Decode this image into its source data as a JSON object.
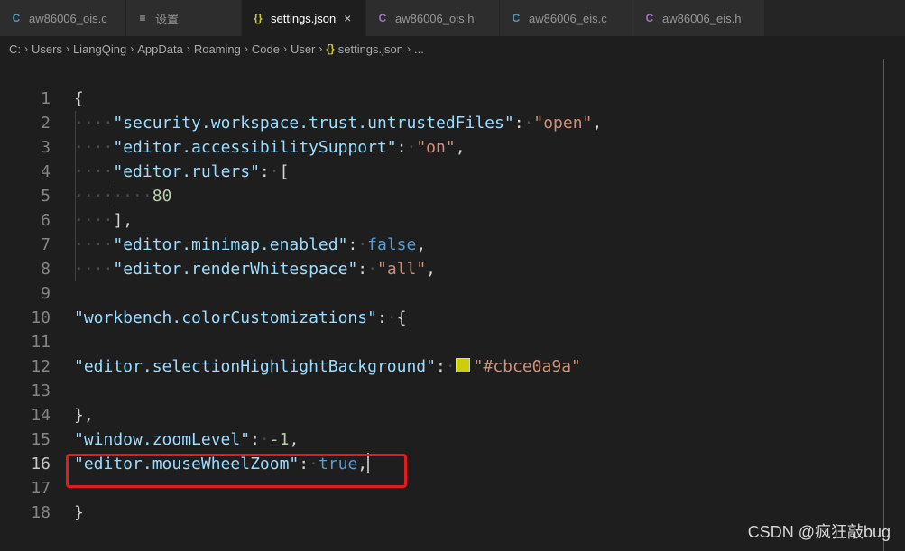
{
  "tabs": [
    {
      "label": "aw86006_ois.c",
      "icon": "C",
      "icon_color": "#519aba",
      "active": false
    },
    {
      "label": "设置",
      "icon": "≡",
      "icon_color": "#c5c5c5",
      "active": false
    },
    {
      "label": "settings.json",
      "icon": "{}",
      "icon_color": "#cbcb41",
      "active": true,
      "close": "×"
    },
    {
      "label": "aw86006_ois.h",
      "icon": "C",
      "icon_color": "#a074c4",
      "active": false
    },
    {
      "label": "aw86006_eis.c",
      "icon": "C",
      "icon_color": "#519aba",
      "active": false
    },
    {
      "label": "aw86006_eis.h",
      "icon": "C",
      "icon_color": "#a074c4",
      "active": false
    }
  ],
  "breadcrumb": {
    "items": [
      "C:",
      "Users",
      "LiangQing",
      "AppData",
      "Roaming",
      "Code",
      "User",
      "settings.json",
      "..."
    ],
    "file_icon": "{}"
  },
  "editor": {
    "current_line": "16",
    "lines": [
      {
        "num": "1",
        "tokens": [
          {
            "t": "p",
            "v": "{"
          }
        ]
      },
      {
        "num": "2",
        "tokens": [
          {
            "t": "ws",
            "v": "····"
          },
          {
            "t": "k",
            "v": "\"security.workspace.trust.untrustedFiles\""
          },
          {
            "t": "p",
            "v": ":"
          },
          {
            "t": "ws",
            "v": "·"
          },
          {
            "t": "s",
            "v": "\"open\""
          },
          {
            "t": "p",
            "v": ","
          }
        ]
      },
      {
        "num": "3",
        "tokens": [
          {
            "t": "ws",
            "v": "····"
          },
          {
            "t": "k",
            "v": "\"editor.accessibilitySupport\""
          },
          {
            "t": "p",
            "v": ":"
          },
          {
            "t": "ws",
            "v": "·"
          },
          {
            "t": "s",
            "v": "\"on\""
          },
          {
            "t": "p",
            "v": ","
          }
        ]
      },
      {
        "num": "4",
        "tokens": [
          {
            "t": "ws",
            "v": "····"
          },
          {
            "t": "k",
            "v": "\"editor.rulers\""
          },
          {
            "t": "p",
            "v": ":"
          },
          {
            "t": "ws",
            "v": "·"
          },
          {
            "t": "p",
            "v": "["
          }
        ]
      },
      {
        "num": "5",
        "tokens": [
          {
            "t": "ws",
            "v": "········"
          },
          {
            "t": "n",
            "v": "80"
          }
        ]
      },
      {
        "num": "6",
        "tokens": [
          {
            "t": "ws",
            "v": "····"
          },
          {
            "t": "p",
            "v": "],"
          }
        ]
      },
      {
        "num": "7",
        "tokens": [
          {
            "t": "ws",
            "v": "····"
          },
          {
            "t": "k",
            "v": "\"editor.minimap.enabled\""
          },
          {
            "t": "p",
            "v": ":"
          },
          {
            "t": "ws",
            "v": "·"
          },
          {
            "t": "b",
            "v": "false"
          },
          {
            "t": "p",
            "v": ","
          }
        ]
      },
      {
        "num": "8",
        "tokens": [
          {
            "t": "ws",
            "v": "····"
          },
          {
            "t": "k",
            "v": "\"editor.renderWhitespace\""
          },
          {
            "t": "p",
            "v": ":"
          },
          {
            "t": "ws",
            "v": "·"
          },
          {
            "t": "s",
            "v": "\"all\""
          },
          {
            "t": "p",
            "v": ","
          }
        ]
      },
      {
        "num": "9",
        "tokens": []
      },
      {
        "num": "10",
        "tokens": [
          {
            "t": "k",
            "v": "\"workbench.colorCustomizations\""
          },
          {
            "t": "p",
            "v": ":"
          },
          {
            "t": "ws",
            "v": "·"
          },
          {
            "t": "p",
            "v": "{"
          }
        ]
      },
      {
        "num": "11",
        "tokens": []
      },
      {
        "num": "12",
        "tokens": [
          {
            "t": "k",
            "v": "\"editor.selectionHighlightBackground\""
          },
          {
            "t": "p",
            "v": ":"
          },
          {
            "t": "ws",
            "v": "·"
          },
          {
            "t": "swatch",
            "v": "#cbce0a"
          },
          {
            "t": "s",
            "v": "\"#cbce0a9a\""
          }
        ]
      },
      {
        "num": "13",
        "tokens": []
      },
      {
        "num": "14",
        "tokens": [
          {
            "t": "p",
            "v": "},"
          }
        ]
      },
      {
        "num": "15",
        "tokens": [
          {
            "t": "k",
            "v": "\"window.zoomLevel\""
          },
          {
            "t": "p",
            "v": ":"
          },
          {
            "t": "ws",
            "v": "·"
          },
          {
            "t": "n",
            "v": "-1"
          },
          {
            "t": "p",
            "v": ","
          }
        ]
      },
      {
        "num": "16",
        "tokens": [
          {
            "t": "k",
            "v": "\"editor.mouseWheelZoom\""
          },
          {
            "t": "p",
            "v": ":"
          },
          {
            "t": "ws",
            "v": "·"
          },
          {
            "t": "b",
            "v": "true"
          },
          {
            "t": "p",
            "v": ","
          },
          {
            "t": "cursor",
            "v": ""
          }
        ]
      },
      {
        "num": "17",
        "tokens": []
      },
      {
        "num": "18",
        "tokens": [
          {
            "t": "p",
            "v": "}"
          }
        ]
      }
    ]
  },
  "highlight_color": "#e31b1b",
  "watermark": "CSDN @疯狂敲bug"
}
